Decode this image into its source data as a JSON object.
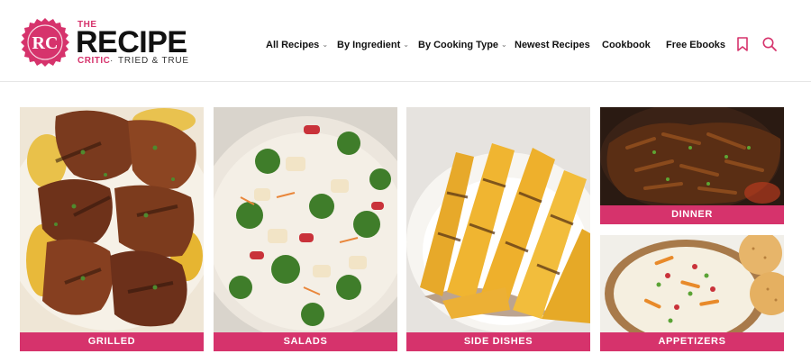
{
  "logo": {
    "monogram": "RC",
    "the": "THE",
    "name": "RECIPE",
    "critic": "CRITIC",
    "separator": "·",
    "tagline": "TRIED & TRUE",
    "brand_color": "#d6336c"
  },
  "nav": {
    "items": [
      {
        "label": "All Recipes",
        "dropdown": true
      },
      {
        "label": "By Ingredient",
        "dropdown": true
      },
      {
        "label": "By Cooking Type",
        "dropdown": true
      },
      {
        "label": "Newest Recipes",
        "dropdown": false
      },
      {
        "label": "Cookbook",
        "dropdown": false
      },
      {
        "label": "Free Ebooks",
        "dropdown": false
      }
    ],
    "icons": [
      "bookmark-icon",
      "search-icon"
    ]
  },
  "categories": [
    {
      "label": "GRILLED",
      "image": "grilled-chicken-photo"
    },
    {
      "label": "SALADS",
      "image": "broccoli-salad-photo"
    },
    {
      "label": "SIDE DISHES",
      "image": "grilled-pineapple-photo"
    },
    {
      "label": "DINNER",
      "image": "shredded-pork-photo"
    },
    {
      "label": "APPETIZERS",
      "image": "dip-and-crackers-photo"
    }
  ],
  "colors": {
    "accent": "#d6336c",
    "text": "#111111",
    "divider": "#e6e6e6"
  }
}
